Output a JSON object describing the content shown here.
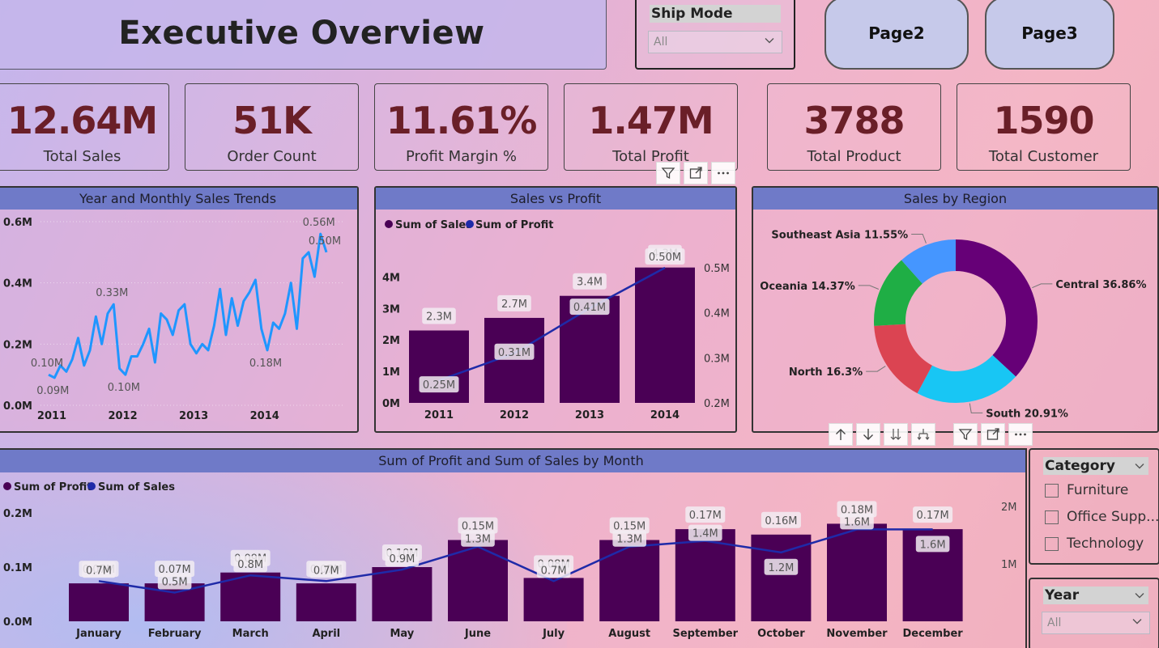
{
  "title": "Executive Overview",
  "ship_mode": {
    "label": "Ship Mode",
    "value": "All"
  },
  "nav": {
    "page2": "Page2",
    "page3": "Page3"
  },
  "kpis": [
    {
      "value": "12.64M",
      "label": "Total Sales"
    },
    {
      "value": "51K",
      "label": "Order Count"
    },
    {
      "value": "11.61%",
      "label": "Profit Margin %"
    },
    {
      "value": "1.47M",
      "label": "Total Profit"
    },
    {
      "value": "3788",
      "label": "Total Product"
    },
    {
      "value": "1590",
      "label": "Total Customer"
    }
  ],
  "icons": {
    "filter": "filter-icon",
    "focus": "focus-mode-icon",
    "more": "more-options-icon",
    "drill_up": "arrow-up-icon",
    "drill_down": "arrow-down-icon",
    "expand_all": "double-arrow-down-icon",
    "expand_next": "fork-arrow-icon"
  },
  "colors": {
    "bar": "#4a0055",
    "line_blue": "#1f96ff",
    "line_navy": "#1f2aa8",
    "header": "#6f7ac8",
    "kpi_value": "#6a1f28"
  },
  "chart_data": [
    {
      "type": "line",
      "title": "Year and Monthly Sales Trends",
      "x_labels": [
        "2011",
        "2012",
        "2013",
        "2014"
      ],
      "y_ticks": [
        "0.0M",
        "0.2M",
        "0.4M",
        "0.6M"
      ],
      "ylim": [
        0,
        0.6
      ],
      "values": [
        0.1,
        0.09,
        0.13,
        0.11,
        0.15,
        0.22,
        0.13,
        0.18,
        0.29,
        0.2,
        0.3,
        0.33,
        0.12,
        0.1,
        0.16,
        0.16,
        0.2,
        0.25,
        0.14,
        0.3,
        0.28,
        0.23,
        0.31,
        0.33,
        0.2,
        0.17,
        0.2,
        0.18,
        0.26,
        0.38,
        0.23,
        0.35,
        0.26,
        0.34,
        0.37,
        0.41,
        0.25,
        0.18,
        0.27,
        0.25,
        0.3,
        0.4,
        0.25,
        0.48,
        0.5,
        0.42,
        0.56,
        0.5
      ],
      "data_labels": [
        {
          "text": "0.10M",
          "index": 0
        },
        {
          "text": "0.09M",
          "index": 1
        },
        {
          "text": "0.33M",
          "index": 11
        },
        {
          "text": "0.10M",
          "index": 13
        },
        {
          "text": "0.18M",
          "index": 37
        },
        {
          "text": "0.56M",
          "index": 46
        },
        {
          "text": "0.50M",
          "index": 47
        }
      ]
    },
    {
      "type": "bar+line",
      "title": "Sales vs Profit",
      "legend": [
        "Sum of Sales",
        "Sum of Profit"
      ],
      "categories": [
        "2011",
        "2012",
        "2013",
        "2014"
      ],
      "series": [
        {
          "name": "Sum of Sales",
          "values": [
            2.3,
            2.7,
            3.4,
            4.3
          ],
          "labels": [
            "2.3M",
            "2.7M",
            "3.4M",
            "4.3M"
          ]
        },
        {
          "name": "Sum of Profit",
          "values": [
            0.25,
            0.31,
            0.41,
            0.5
          ],
          "labels": [
            "0.25M",
            "0.31M",
            "0.41M",
            "0.50M"
          ]
        }
      ],
      "y_left_ticks": [
        "0M",
        "1M",
        "2M",
        "3M",
        "4M"
      ],
      "y_right_ticks": [
        "0.2M",
        "0.3M",
        "0.4M",
        "0.5M"
      ],
      "ylim_left": [
        0,
        4.6
      ],
      "ylim_right": [
        0.2,
        0.5
      ]
    },
    {
      "type": "pie",
      "title": "Sales by Region",
      "slices": [
        {
          "label": "Central",
          "value": 36.86,
          "text": "Central 36.86%",
          "color": "#660077"
        },
        {
          "label": "South",
          "value": 20.91,
          "text": "South 20.91%",
          "color": "#18c6f4"
        },
        {
          "label": "North",
          "value": 16.3,
          "text": "North 16.3%",
          "color": "#db4452"
        },
        {
          "label": "Oceania",
          "value": 14.37,
          "text": "Oceania 14.37%",
          "color": "#1fae45"
        },
        {
          "label": "Southeast Asia",
          "value": 11.55,
          "text": "Southeast Asia 11.55%",
          "color": "#4596ff"
        }
      ]
    },
    {
      "type": "bar+line",
      "title": "Sum of Profit and Sum of Sales by Month",
      "legend": [
        "Sum of Profit",
        "Sum of Sales"
      ],
      "categories": [
        "January",
        "February",
        "March",
        "April",
        "May",
        "June",
        "July",
        "August",
        "September",
        "October",
        "November",
        "December"
      ],
      "series": [
        {
          "name": "Sum of Profit",
          "values": [
            0.07,
            0.07,
            0.09,
            0.07,
            0.1,
            0.15,
            0.08,
            0.15,
            0.17,
            0.16,
            0.18,
            0.17
          ],
          "labels": [
            "0.07M",
            "0.07M",
            "0.09M",
            "0.07M",
            "0.10M",
            "0.15M",
            "0.08M",
            "0.15M",
            "0.17M",
            "0.16M",
            "0.18M",
            "0.17M"
          ]
        },
        {
          "name": "Sum of Sales",
          "values": [
            0.7,
            0.5,
            0.8,
            0.7,
            0.9,
            1.3,
            0.7,
            1.3,
            1.4,
            1.2,
            1.6,
            1.6
          ],
          "labels": [
            "0.7M",
            "0.5M",
            "0.8M",
            "0.7M",
            "0.9M",
            "1.3M",
            "0.7M",
            "1.3M",
            "1.4M",
            "1.2M",
            "1.6M",
            "1.6M"
          ]
        }
      ],
      "y_left_ticks": [
        "0.0M",
        "0.1M",
        "0.2M"
      ],
      "y_right_ticks": [
        "1M",
        "2M"
      ],
      "ylim_left": [
        0,
        0.2
      ],
      "ylim_right": [
        0,
        2
      ]
    }
  ],
  "category_slicer": {
    "label": "Category",
    "items": [
      "Furniture",
      "Office Supp...",
      "Technology"
    ]
  },
  "year_slicer": {
    "label": "Year",
    "value": "All"
  }
}
